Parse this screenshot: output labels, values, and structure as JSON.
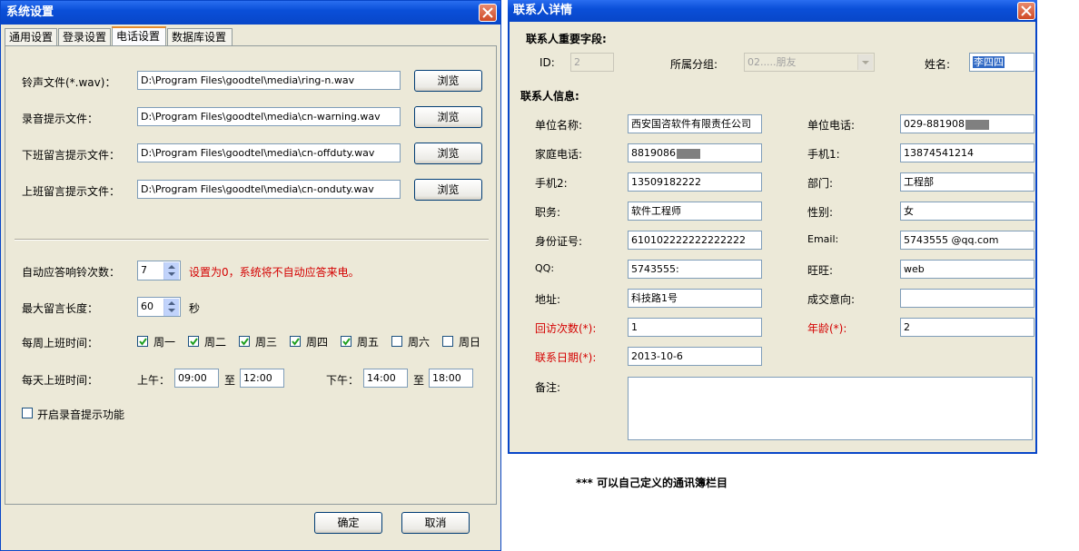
{
  "settings": {
    "title": "系统设置",
    "tabs": [
      "通用设置",
      "登录设置",
      "电话设置",
      "数据库设置"
    ],
    "active_tab": 2,
    "rows": [
      {
        "label": "铃声文件(*.wav)：",
        "value": "D:\\Program Files\\goodtel\\media\\ring-n.wav",
        "button": "浏览"
      },
      {
        "label": "录音提示文件：",
        "value": "D:\\Program Files\\goodtel\\media\\cn-warning.wav",
        "button": "浏览"
      },
      {
        "label": "下班留言提示文件：",
        "value": "D:\\Program Files\\goodtel\\media\\cn-offduty.wav",
        "button": "浏览"
      },
      {
        "label": "上班留言提示文件：",
        "value": "D:\\Program Files\\goodtel\\media\\cn-onduty.wav",
        "button": "浏览"
      }
    ],
    "auto_answer": {
      "label": "自动应答响铃次数：",
      "value": "7",
      "hint": "设置为0，系统将不自动应答来电。"
    },
    "max_msg": {
      "label": "最大留言长度：",
      "value": "60",
      "unit": "秒"
    },
    "weekdays": {
      "label": "每周上班时间：",
      "days": [
        {
          "name": "周一",
          "checked": true
        },
        {
          "name": "周二",
          "checked": true
        },
        {
          "name": "周三",
          "checked": true
        },
        {
          "name": "周四",
          "checked": true
        },
        {
          "name": "周五",
          "checked": true
        },
        {
          "name": "周六",
          "checked": false
        },
        {
          "name": "周日",
          "checked": false
        }
      ]
    },
    "daily": {
      "label": "每天上班时间：",
      "am_label": "上午：",
      "am_start": "09:00",
      "am_to": "至",
      "am_end": "12:00",
      "pm_label": "下午：",
      "pm_start": "14:00",
      "pm_to": "至",
      "pm_end": "18:00"
    },
    "record_prompt": {
      "label": "开启录音提示功能",
      "checked": false
    },
    "ok": "确定",
    "cancel": "取消"
  },
  "contact": {
    "title": "联系人详情",
    "important_header": "联系人重要字段:",
    "id_label": "ID:",
    "id_value": "2",
    "group_label": "所属分组:",
    "group_value": "02.....朋友",
    "name_label": "姓名:",
    "name_value": "李四四",
    "info_header": "联系人信息:",
    "fields_left": [
      {
        "label": "单位名称:",
        "value": "西安国咨软件有限责任公司"
      },
      {
        "label": "家庭电话:",
        "value": "8819086"
      },
      {
        "label": "手机2:",
        "value": "13509182222"
      },
      {
        "label": "职务:",
        "value": "软件工程师"
      },
      {
        "label": "身份证号:",
        "value": "610102222222222222"
      },
      {
        "label": "QQ:",
        "value": "5743555:"
      },
      {
        "label": "地址:",
        "value": "科技路1号"
      },
      {
        "label": "回访次数(*):",
        "value": "1"
      },
      {
        "label": "联系日期(*):",
        "value": "2013-10-6"
      }
    ],
    "fields_right": [
      {
        "label": "单位电话:",
        "value": "029-881908"
      },
      {
        "label": "手机1:",
        "value": "13874541214"
      },
      {
        "label": "部门:",
        "value": "工程部"
      },
      {
        "label": "性别:",
        "value": "女"
      },
      {
        "label": "Email:",
        "value": "5743555    @qq.com"
      },
      {
        "label": "旺旺:",
        "value": "web"
      },
      {
        "label": "成交意向:",
        "value": ""
      },
      {
        "label": "年龄(*):",
        "value": "2"
      }
    ],
    "remark_label": "备注:",
    "remark_value": "",
    "colors": {
      "required_label": "#d40000"
    }
  },
  "caption": "*** 可以自己定义的通讯簿栏目"
}
